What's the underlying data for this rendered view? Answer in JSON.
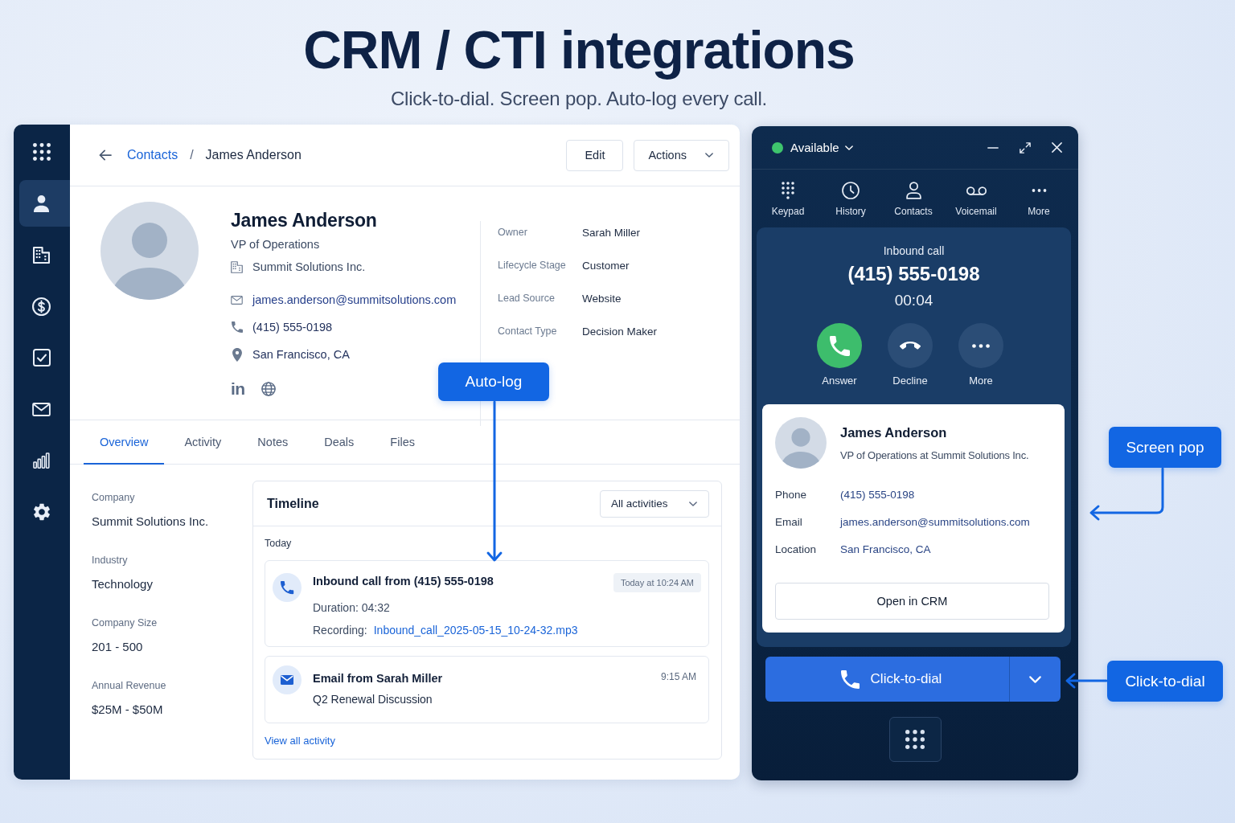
{
  "header": {
    "title": "CRM / CTI integrations",
    "subtitle": "Click-to-dial. Screen pop. Auto-log every call."
  },
  "crm": {
    "sidebar": {
      "items": [
        {
          "kind": "apps",
          "selected": false
        },
        {
          "kind": "contacts",
          "selected": true
        },
        {
          "kind": "companies",
          "selected": false
        },
        {
          "kind": "deals",
          "selected": false
        },
        {
          "kind": "tasks",
          "selected": false
        },
        {
          "kind": "mail",
          "selected": false
        },
        {
          "kind": "reports",
          "selected": false
        },
        {
          "kind": "settings",
          "selected": false
        }
      ]
    },
    "breadcrumb": {
      "link": "Contacts",
      "separator": "/",
      "current": "James Anderson"
    },
    "buttons": [
      {
        "kind": "plain",
        "label": "Edit"
      },
      {
        "kind": "menu",
        "label": "Actions"
      }
    ],
    "profile": {
      "name": "James Anderson",
      "title": "VP of Operations",
      "company": "Summit Solutions Inc.",
      "contacts": [
        {
          "kind": "email",
          "text": "james.anderson@summitsolutions.com"
        },
        {
          "kind": "phone",
          "text": "(415) 555-0198"
        },
        {
          "kind": "location",
          "text": "San Francisco, CA"
        }
      ],
      "social_label": "in"
    },
    "details": [
      {
        "label": "Owner",
        "value": "Sarah Miller"
      },
      {
        "label": "Lifecycle Stage",
        "value": "Customer"
      },
      {
        "label": "Lead Source",
        "value": "Website"
      },
      {
        "label": "Contact Type",
        "value": "Decision Maker"
      }
    ],
    "tabs": [
      {
        "label": "Overview",
        "selected": true
      },
      {
        "label": "Activity",
        "selected": false
      },
      {
        "label": "Notes",
        "selected": false
      },
      {
        "label": "Deals",
        "selected": false
      },
      {
        "label": "Files",
        "selected": false
      }
    ],
    "fields": [
      {
        "label": "Company",
        "value": "Summit Solutions Inc."
      },
      {
        "label": "Industry",
        "value": "Technology"
      },
      {
        "label": "Company Size",
        "value": "201 - 500"
      },
      {
        "label": "Annual Revenue",
        "value": "$25M - $50M"
      }
    ],
    "timeline": {
      "title": "Timeline",
      "filter": "All activities",
      "group": "Today",
      "items": [
        {
          "kind": "call",
          "title": "Inbound call from (415) 555-0198",
          "time": "Today at 10:24 AM",
          "duration": "Duration: 04:32",
          "recording_label": "Recording:",
          "recording_file": "Inbound_call_2025-05-15_10-24-32.mp3"
        },
        {
          "kind": "email",
          "title": "Email from Sarah Miller",
          "time": "9:15 AM",
          "subject": "Q2 Renewal Discussion"
        }
      ],
      "footer_link": "View all activity"
    }
  },
  "softphone": {
    "status": {
      "label": "Available",
      "color": "#3ec46d"
    },
    "nav": [
      {
        "kind": "keypad",
        "label": "Keypad"
      },
      {
        "kind": "history",
        "label": "History"
      },
      {
        "kind": "contacts",
        "label": "Contacts"
      },
      {
        "kind": "voicemail",
        "label": "Voicemail"
      },
      {
        "kind": "more",
        "label": "More"
      }
    ],
    "call": {
      "direction": "Inbound call",
      "number": "(415) 555-0198",
      "timer": "00:04",
      "actions": [
        {
          "kind": "answer",
          "label": "Answer"
        },
        {
          "kind": "decline",
          "label": "Decline"
        },
        {
          "kind": "more",
          "label": "More"
        }
      ]
    },
    "screen_pop": {
      "name": "James Anderson",
      "subtitle": "VP of Operations at Summit Solutions Inc.",
      "fields": [
        {
          "label": "Phone",
          "value": "(415) 555-0198"
        },
        {
          "label": "Email",
          "value": "james.anderson@summitsolutions.com"
        },
        {
          "label": "Location",
          "value": "San Francisco, CA"
        }
      ],
      "button": "Open in CRM"
    },
    "dial_button": "Click-to-dial"
  },
  "callouts": [
    {
      "label": "Auto-log"
    },
    {
      "label": "Screen pop"
    },
    {
      "label": "Click-to-dial"
    }
  ]
}
